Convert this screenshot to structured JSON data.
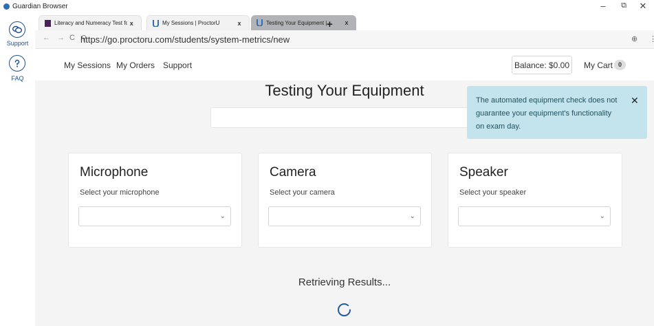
{
  "window": {
    "title": "Guardian Browser",
    "min_glyph": "–",
    "max_glyph": "⧉",
    "close_glyph": "✕"
  },
  "rail": {
    "support_label": "Support",
    "faq_label": "FAQ"
  },
  "tabs": [
    {
      "label": "Literacy and Numeracy Test for",
      "close": "x",
      "favicon_color": "#4b1f5e"
    },
    {
      "label": "My Sessions | ProctorU",
      "close": "x",
      "favicon_color": "#2c6fb5"
    },
    {
      "label": "Testing Your Equipment |",
      "close": "x",
      "favicon_color": "#2c6fb5"
    }
  ],
  "new_tab_label": "+",
  "address_bar": {
    "back": "←",
    "forward": "→",
    "reload": "C",
    "search_glyph": "⚲",
    "url": "https://go.proctoru.com/students/system-metrics/new",
    "zoom_glyph": "⊕",
    "menu_glyph": "⋮"
  },
  "header": {
    "nav": [
      "My Sessions",
      "My Orders",
      "Support"
    ],
    "balance": "Balance: $0.00",
    "cart_label": "My Cart",
    "cart_count": "0"
  },
  "main": {
    "title": "Testing Your Equipment",
    "retrieving": "Retrieving Results..."
  },
  "toast": {
    "message": "The automated equipment check does not guarantee your equipment's functionality on exam day.",
    "close": "✕"
  },
  "cards": [
    {
      "title": "Microphone",
      "subtitle": "Select your microphone",
      "selected": ""
    },
    {
      "title": "Camera",
      "subtitle": "Select your camera",
      "selected": ""
    },
    {
      "title": "Speaker",
      "subtitle": "Select your speaker",
      "selected": ""
    }
  ],
  "colors": {
    "brand": "#1b4d8c",
    "toast_bg": "#c3e4ec",
    "spinner": "#1f5c9e"
  }
}
